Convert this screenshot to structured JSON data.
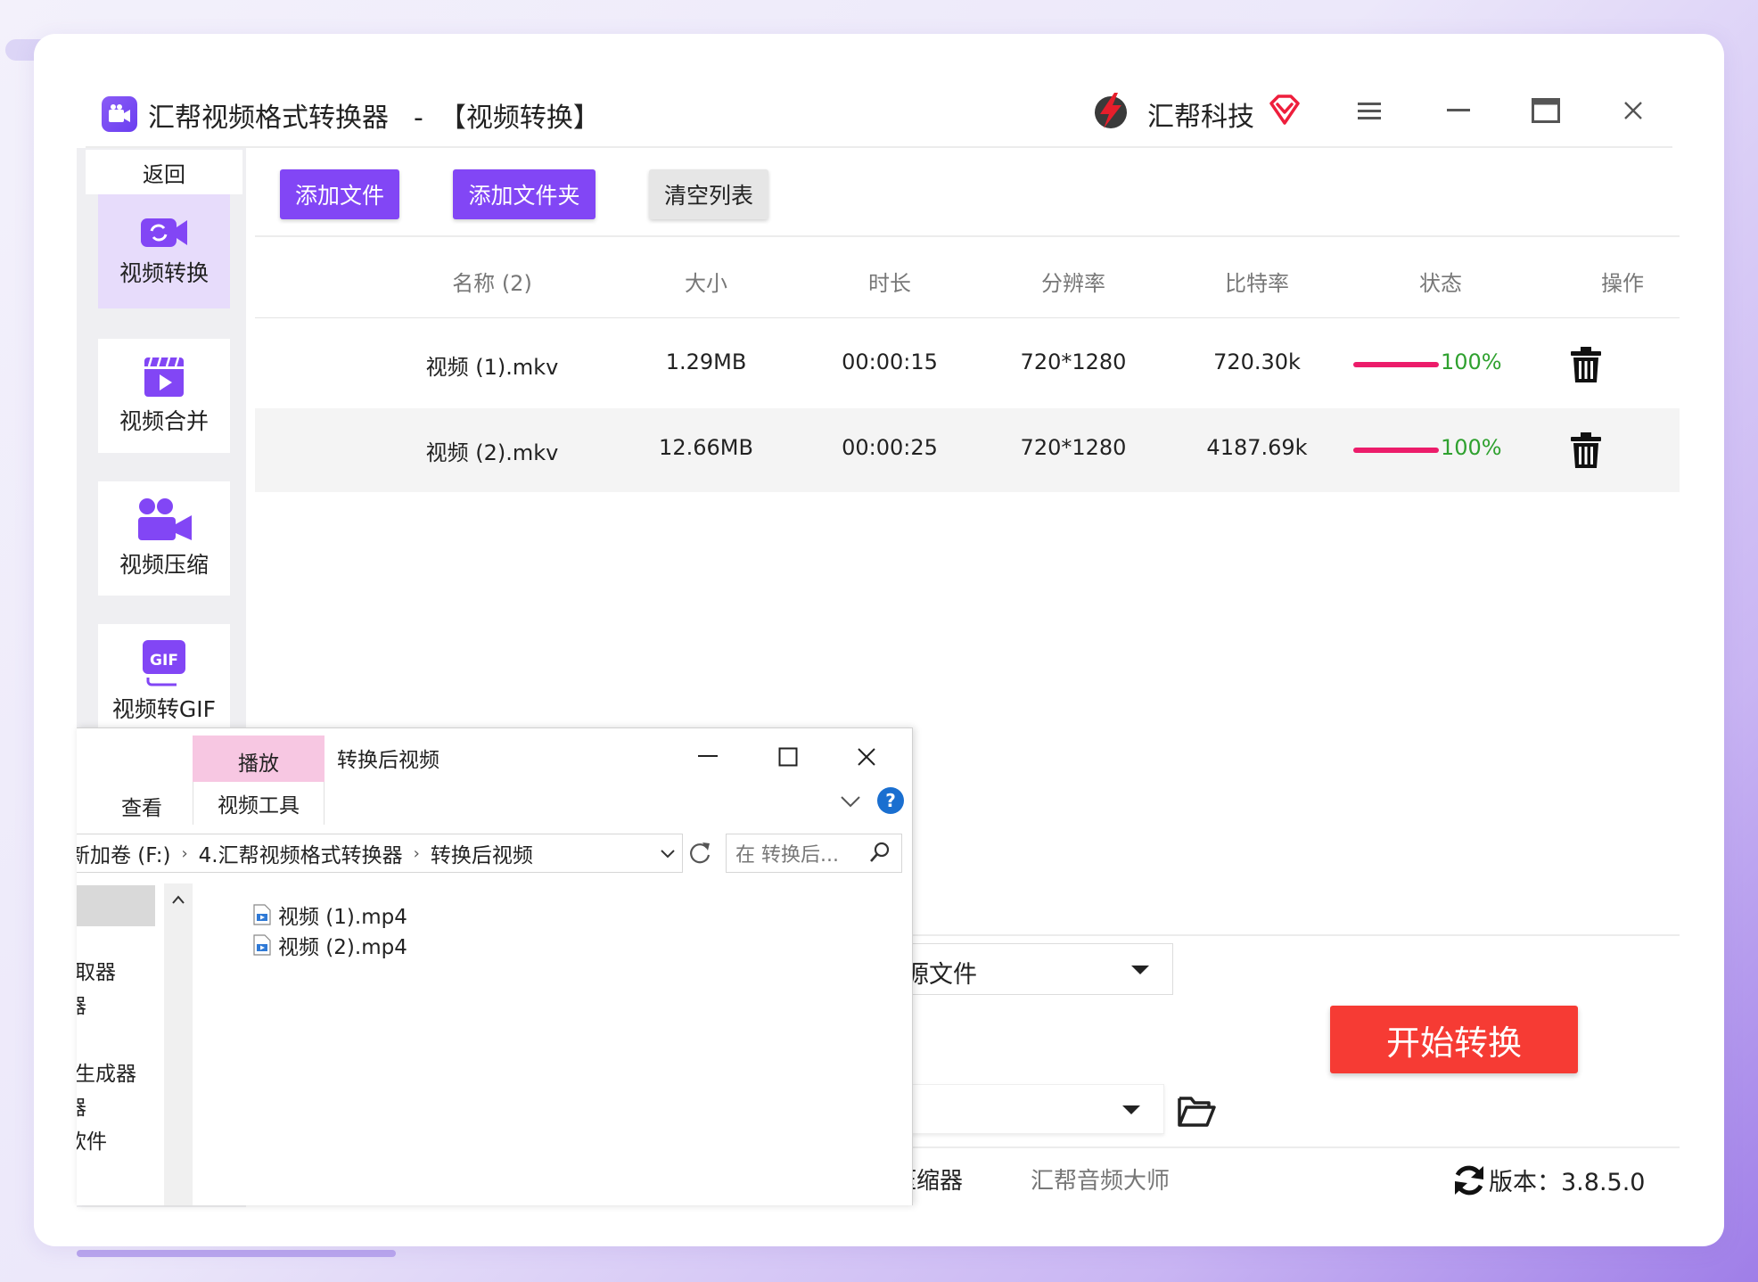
{
  "window": {
    "title": "汇帮视频格式转换器",
    "separator": "-",
    "section": "【视频转换】",
    "brand_name": "汇帮科技"
  },
  "sidebar": {
    "back_label": "返回",
    "items": [
      {
        "label": "视频转换",
        "icon": "video-convert-icon",
        "active": true
      },
      {
        "label": "视频合并",
        "icon": "video-merge-icon",
        "active": false
      },
      {
        "label": "视频压缩",
        "icon": "video-compress-icon",
        "active": false
      },
      {
        "label": "视频转GIF",
        "icon": "gif-icon",
        "active": false
      }
    ]
  },
  "toolbar": {
    "add_file": "添加文件",
    "add_folder": "添加文件夹",
    "clear_list": "清空列表"
  },
  "table": {
    "columns": [
      "名称 (2)",
      "大小",
      "时长",
      "分辨率",
      "比特率",
      "状态",
      "操作"
    ],
    "rows": [
      {
        "name": "视频 (1).mkv",
        "size": "1.29MB",
        "duration": "00:00:15",
        "resolution": "720*1280",
        "bitrate": "720.30k",
        "progress": 1.0,
        "status": "100%"
      },
      {
        "name": "视频 (2).mkv",
        "size": "12.66MB",
        "duration": "00:00:25",
        "resolution": "720*1280",
        "bitrate": "4187.69k",
        "progress": 1.0,
        "status": "100%"
      }
    ]
  },
  "bottom": {
    "output_format_partial": "源文件",
    "start_button": "开始转换",
    "footer_link_1": "压缩器",
    "footer_link_2": "汇帮音频大师",
    "version": "版本：3.8.5.0"
  },
  "explorer": {
    "title": "转换后视频",
    "tab_play": "播放",
    "tab_tools": "视频工具",
    "tab_view": "查看",
    "breadcrumb": [
      "新加卷 (F:)",
      "4.汇帮视频格式转换器",
      "转换后视频"
    ],
    "search_placeholder": "在 转换后...",
    "nav_items": [
      "取器",
      "器",
      "生成器",
      "器",
      "软件"
    ],
    "files": [
      "视频 (1).mp4",
      "视频 (2).mp4"
    ]
  },
  "colors": {
    "accent": "#8246f5",
    "start": "#f63b34",
    "progress": "#ec1c6a",
    "success": "#2fa12f"
  }
}
